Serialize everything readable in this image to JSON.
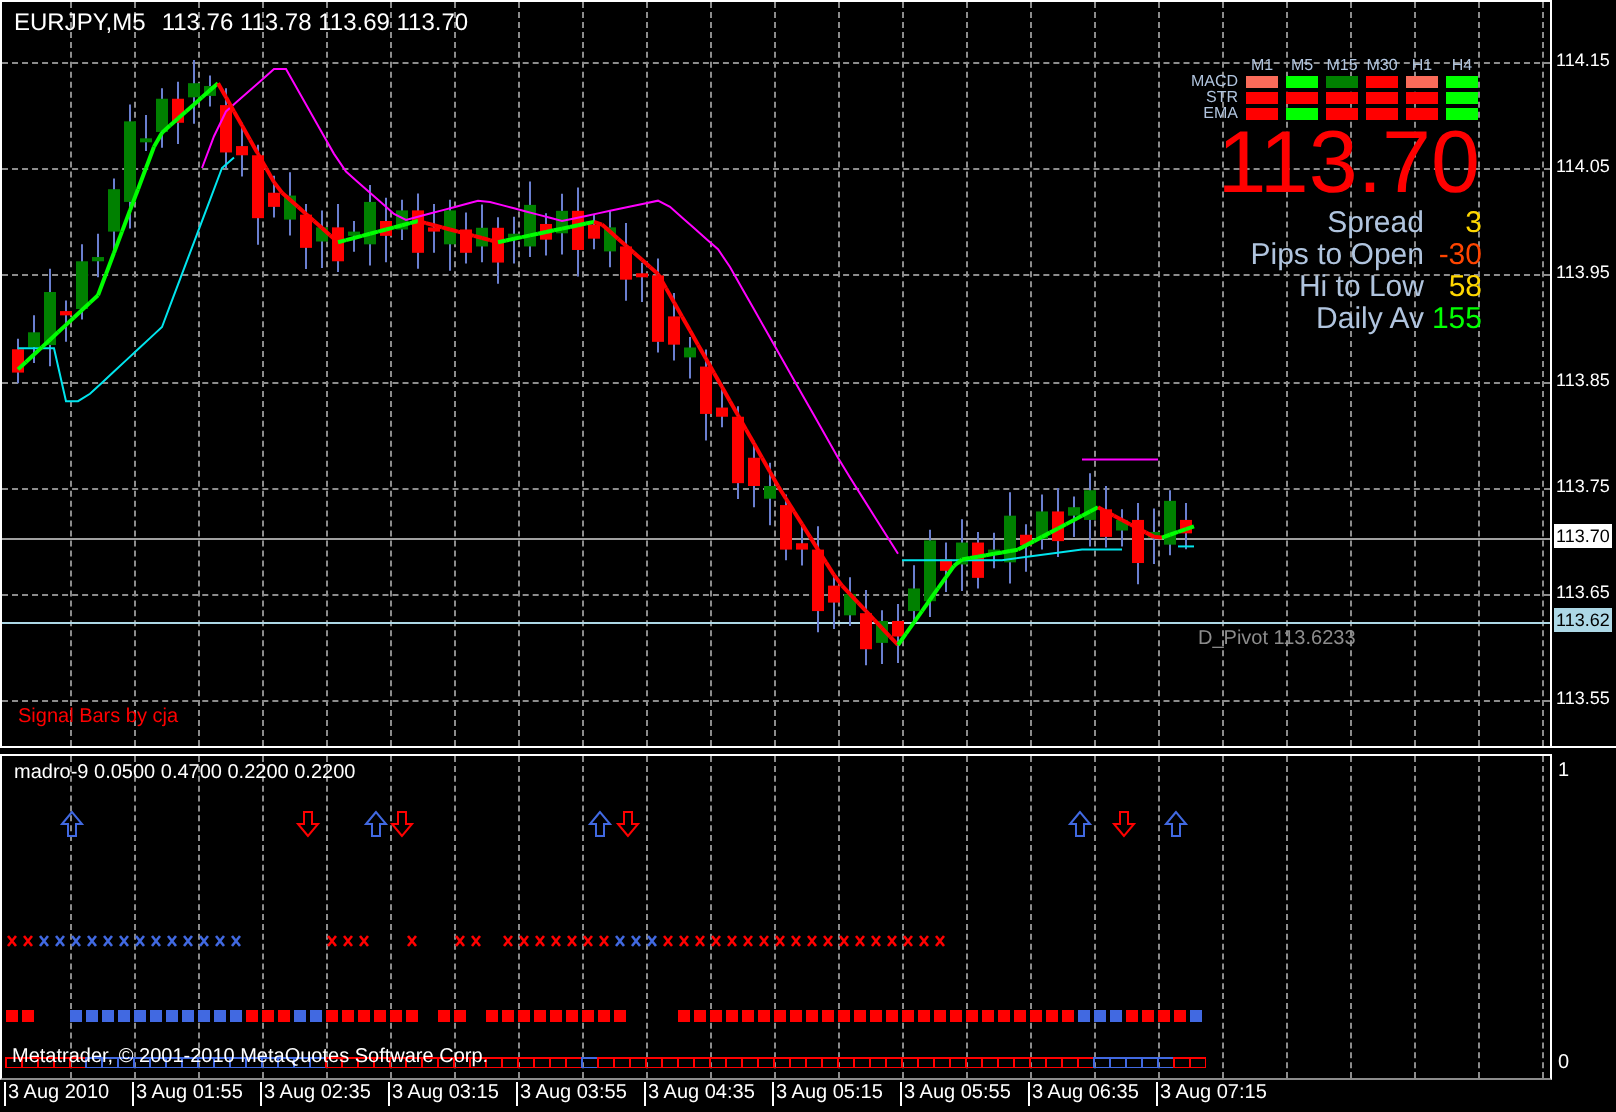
{
  "chart": {
    "symbol": "EURJPY,M5",
    "ohlc": "113.76 113.78 113.69 113.70",
    "signature": "Signal Bars by cja",
    "pivot_label": "D_Pivot 113.6233"
  },
  "signal_panel": {
    "timeframes": [
      "M1",
      "M5",
      "M15",
      "M30",
      "H1",
      "H4"
    ],
    "rows": [
      {
        "label": "MACD",
        "cells": [
          {
            "color": "#fa6b5a"
          },
          {
            "color": "#00ff00"
          },
          {
            "color": "#008000"
          },
          {
            "color": "#ff0000"
          },
          {
            "color": "#fa6b5a"
          },
          {
            "color": "#00ff00"
          }
        ]
      },
      {
        "label": "STR",
        "cells": [
          {
            "color": "#ff0000"
          },
          {
            "color": "#ff0000"
          },
          {
            "color": "#ff0000"
          },
          {
            "color": "#ff0000"
          },
          {
            "color": "#ff0000"
          },
          {
            "color": "#00ff00"
          }
        ]
      },
      {
        "label": "EMA",
        "cells": [
          {
            "color": "#ff0000"
          },
          {
            "color": "#00ff00"
          },
          {
            "color": "#ff0000"
          },
          {
            "color": "#ff0000"
          },
          {
            "color": "#ff0000"
          },
          {
            "color": "#00ff00"
          }
        ]
      }
    ]
  },
  "price": "113.70",
  "stats": [
    {
      "label": "Spread",
      "value": "3",
      "color": "#ffd700"
    },
    {
      "label": "Pips to Open",
      "value": "-30",
      "color": "#ff4500"
    },
    {
      "label": "Hi to Low",
      "value": "58",
      "color": "#ffd700"
    },
    {
      "label": "Daily Av",
      "value": "155",
      "color": "#00ff00"
    }
  ],
  "price_axis": {
    "ticks": [
      "114.15",
      "114.05",
      "113.95",
      "113.85",
      "113.75",
      "113.65",
      "113.55"
    ],
    "current_price": "113.70",
    "pivot_price": "113.62"
  },
  "indicator": {
    "title": "madro-9 0.0500 0.4700 0.2200 0.2200",
    "axis": [
      "1",
      "0"
    ],
    "copyright": "Metatrader, © 2001-2010 MetaQuotes Software Corp."
  },
  "time_axis": {
    "labels": [
      "3 Aug 2010",
      "3 Aug 01:55",
      "3 Aug 02:35",
      "3 Aug 03:15",
      "3 Aug 03:55",
      "3 Aug 04:35",
      "3 Aug 05:15",
      "3 Aug 05:55",
      "3 Aug 06:35",
      "3 Aug 07:15"
    ]
  }
}
